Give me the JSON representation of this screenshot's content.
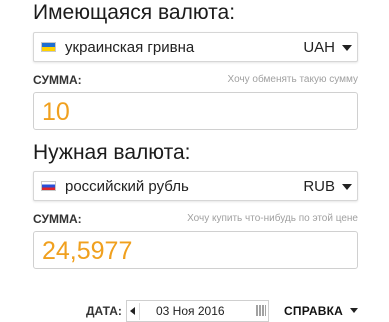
{
  "have": {
    "title": "Имеющаяся валюта:",
    "currency_name": "украинская гривна",
    "currency_code": "UAH",
    "flag_icon": "ukraine-flag",
    "amount_label": "СУММА:",
    "amount_hint": "Хочу обменять такую сумму",
    "amount_value": "10"
  },
  "want": {
    "title": "Нужная валюта:",
    "currency_name": "российский рубль",
    "currency_code": "RUB",
    "flag_icon": "russia-flag",
    "amount_label": "СУММА:",
    "amount_hint": "Хочу купить что-нибудь по этой цене",
    "amount_value": "24,5977"
  },
  "footer": {
    "date_label": "ДАТА:",
    "date_value": "03 Ноя 2016",
    "help_label": "СПРАВКА"
  },
  "colors": {
    "amount_text": "#f0a01e",
    "border": "#d0d0d0"
  }
}
